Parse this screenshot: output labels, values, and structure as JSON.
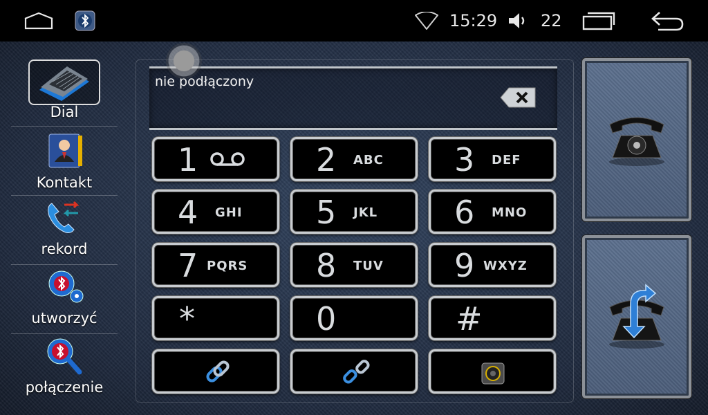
{
  "statusbar": {
    "time": "15:29",
    "volume": "22",
    "icons": [
      "home-icon",
      "bluetooth-app-icon",
      "wifi-icon",
      "volume-icon",
      "recent-apps-icon",
      "back-icon"
    ]
  },
  "sidebar": {
    "items": [
      {
        "label": "Dial",
        "icon": "keyboard-icon",
        "active": true
      },
      {
        "label": "Kontakt",
        "icon": "contacts-book-icon"
      },
      {
        "label": "rekord",
        "icon": "call-log-icon"
      },
      {
        "label": "utworzyć",
        "icon": "bluetooth-settings-icon"
      },
      {
        "label": "połączenie",
        "icon": "bluetooth-search-icon"
      }
    ]
  },
  "display": {
    "status": "nie podłączony",
    "backspace_icon": "backspace-icon"
  },
  "keypad": {
    "keys": [
      {
        "digit": "1",
        "letters": "",
        "icon": "voicemail-icon"
      },
      {
        "digit": "2",
        "letters": "ABC"
      },
      {
        "digit": "3",
        "letters": "DEF"
      },
      {
        "digit": "4",
        "letters": "GHI"
      },
      {
        "digit": "5",
        "letters": "JKL"
      },
      {
        "digit": "6",
        "letters": "MNO"
      },
      {
        "digit": "7",
        "letters": "PQRS"
      },
      {
        "digit": "8",
        "letters": "TUV"
      },
      {
        "digit": "9",
        "letters": "WXYZ"
      },
      {
        "digit": "*",
        "letters": ""
      },
      {
        "digit": "0",
        "letters": ""
      },
      {
        "digit": "#",
        "letters": ""
      }
    ],
    "bottom": [
      "link-icon",
      "unlink-icon",
      "speaker-icon"
    ]
  },
  "actions": {
    "call": "old-telephone-icon",
    "hangup": "telephone-redial-icon"
  },
  "colors": {
    "accent_blue": "#2e7fd6",
    "key_border": "#c8ccd0",
    "background": "#263249"
  }
}
